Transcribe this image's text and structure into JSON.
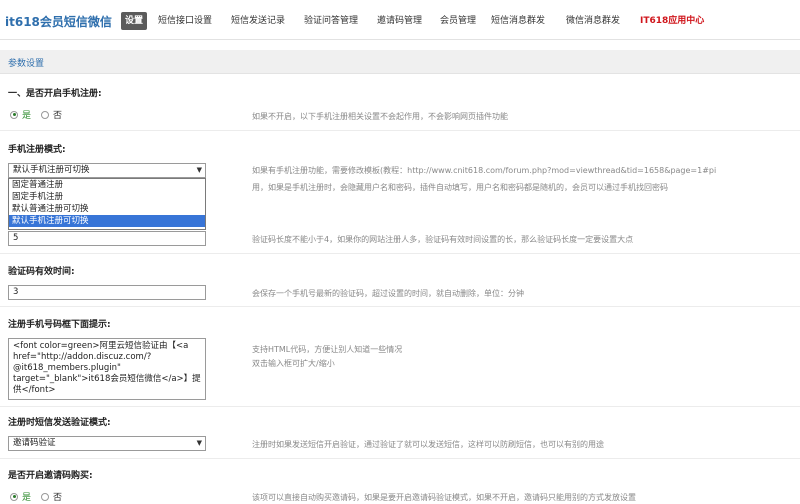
{
  "header": {
    "brand": "it618会员短信微信",
    "tabs": [
      {
        "label": "设置",
        "active": true
      },
      {
        "label": "短信接口设置"
      },
      {
        "label": "短信发送记录"
      },
      {
        "label": "验证问答管理"
      },
      {
        "label": "邀请码管理"
      },
      {
        "label": "会员管理"
      },
      {
        "label": "短信消息群发"
      },
      {
        "label": "微信消息群发"
      },
      {
        "label": "IT618应用中心",
        "highlight": true
      }
    ]
  },
  "section": {
    "title": "参数设置"
  },
  "settings": {
    "mobile_reg": {
      "label": "一、是否开启手机注册:",
      "yes": "是",
      "no": "否",
      "help": "如果不开启，以下手机注册相关设置不会起作用，不会影响网页插件功能"
    },
    "reg_mode": {
      "label": "手机注册模式:",
      "value": "默认手机注册可切换",
      "options": [
        "固定普通注册",
        "固定手机注册",
        "默认普通注册可切换",
        "默认手机注册可切换"
      ],
      "help_line1": "如果有手机注册功能，需要修改模板(教程：http://www.cnit618.com/forum.php?mod=viewthread&tid=1658&page=1#pi",
      "help_line2": "用，如果是手机注册时，会隐藏用户名和密码，插件自动填写，用户名和密码都是随机的，会员可以通过手机找回密码"
    },
    "code_length": {
      "value": "5",
      "help": "验证码长度不能小于4，如果你的网站注册人多，验证码有效时间设置的长，那么验证码长度一定要设置大点"
    },
    "code_valid": {
      "label": "验证码有效时间:",
      "value": "3",
      "help": "会保存一个手机号最新的验证码，超过设置的时间，就自动删除，单位：分钟"
    },
    "reg_tip": {
      "label": "注册手机号码框下面提示:",
      "value": "<font color=green>阿里云短信验证由【<a href=\"http://addon.discuz.com/?@it618_members.plugin\" target=\"_blank\">it618会员短信微信</a>】提供</font>",
      "help_line1": "支持HTML代码，方便让别人知道一些情况",
      "help_line2": "双击输入框可扩大/缩小"
    },
    "send_mode": {
      "label": "注册时短信发送验证模式:",
      "value": "邀请码验证",
      "help": "注册时如果发送短信开启验证，通过验证了就可以发送短信，这样可以防刷短信，也可以有别的用途"
    },
    "invite_buy": {
      "label": "是否开启邀请码购买:",
      "yes": "是",
      "no": "否",
      "help": "该项可以直接自动购买邀请码，如果是要开启邀请码验证模式，如果不开启，邀请码只能用别的方式发放设置"
    }
  }
}
